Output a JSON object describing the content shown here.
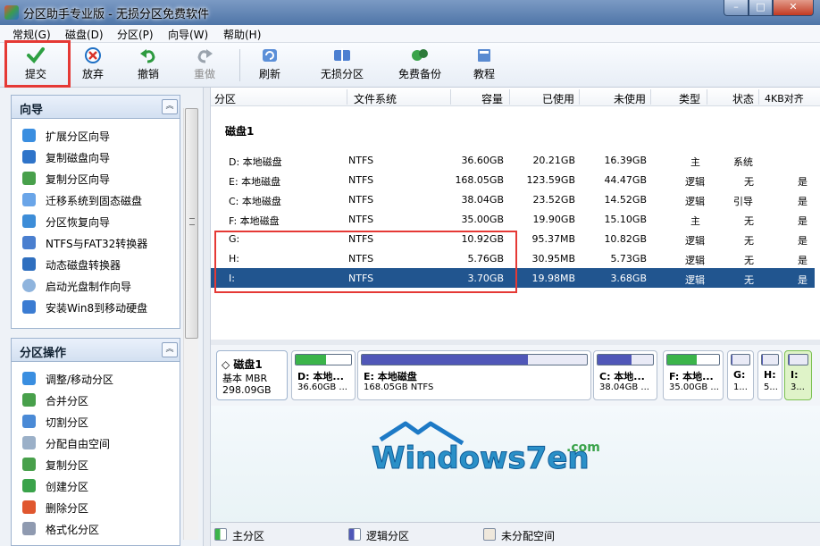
{
  "window": {
    "title": "分区助手专业版 - 无损分区免费软件",
    "min": "–",
    "max": "□",
    "close": "✕"
  },
  "menu": [
    "常规(G)",
    "磁盘(D)",
    "分区(P)",
    "向导(W)",
    "帮助(H)"
  ],
  "toolbar": {
    "submit": "提交",
    "discard": "放弃",
    "undo": "撤销",
    "redo": "重做",
    "refresh": "刷新",
    "lossless": "无损分区",
    "backup": "免费备份",
    "tutorial": "教程"
  },
  "wizard_panel": {
    "title": "向导",
    "items": [
      "扩展分区向导",
      "复制磁盘向导",
      "复制分区向导",
      "迁移系统到固态磁盘",
      "分区恢复向导",
      "NTFS与FAT32转换器",
      "动态磁盘转换器",
      "启动光盘制作向导",
      "安装Win8到移动硬盘"
    ]
  },
  "partition_panel": {
    "title": "分区操作",
    "items": [
      "调整/移动分区",
      "合并分区",
      "切割分区",
      "分配自由空间",
      "复制分区",
      "创建分区",
      "删除分区",
      "格式化分区"
    ]
  },
  "columns": [
    "分区",
    "文件系统",
    "容量",
    "已使用",
    "未使用",
    "类型",
    "状态",
    "4KB对齐"
  ],
  "disk_title": "磁盘1",
  "partitions": [
    {
      "name": "D: 本地磁盘",
      "fs": "NTFS",
      "capacity": "36.60GB",
      "used": "20.21GB",
      "free": "16.39GB",
      "type": "主",
      "status": "系统",
      "align": ""
    },
    {
      "name": "E: 本地磁盘",
      "fs": "NTFS",
      "capacity": "168.05GB",
      "used": "123.59GB",
      "free": "44.47GB",
      "type": "逻辑",
      "status": "无",
      "align": "是"
    },
    {
      "name": "C: 本地磁盘",
      "fs": "NTFS",
      "capacity": "38.04GB",
      "used": "23.52GB",
      "free": "14.52GB",
      "type": "逻辑",
      "status": "引导",
      "align": "是"
    },
    {
      "name": "F: 本地磁盘",
      "fs": "NTFS",
      "capacity": "35.00GB",
      "used": "19.90GB",
      "free": "15.10GB",
      "type": "主",
      "status": "无",
      "align": "是"
    },
    {
      "name": "G:",
      "fs": "NTFS",
      "capacity": "10.92GB",
      "used": "95.37MB",
      "free": "10.82GB",
      "type": "逻辑",
      "status": "无",
      "align": "是"
    },
    {
      "name": "H:",
      "fs": "NTFS",
      "capacity": "5.76GB",
      "used": "30.95MB",
      "free": "5.73GB",
      "type": "逻辑",
      "status": "无",
      "align": "是"
    },
    {
      "name": "I:",
      "fs": "NTFS",
      "capacity": "3.70GB",
      "used": "19.98MB",
      "free": "3.68GB",
      "type": "逻辑",
      "status": "无",
      "align": "是"
    }
  ],
  "diskmap": {
    "disk": {
      "name": "磁盘1",
      "kind": "基本 MBR",
      "size": "298.09GB"
    },
    "boxes": [
      {
        "name": "D: 本地...",
        "size": "36.60GB ...",
        "used_frac": 0.55,
        "kind": "primary"
      },
      {
        "name": "E: 本地磁盘",
        "size": "168.05GB NTFS",
        "used_frac": 0.74,
        "kind": "logical"
      },
      {
        "name": "C: 本地...",
        "size": "38.04GB ...",
        "used_frac": 0.62,
        "kind": "logical"
      },
      {
        "name": "F: 本地...",
        "size": "35.00GB ...",
        "used_frac": 0.57,
        "kind": "primary"
      },
      {
        "name": "G:",
        "size": "1...",
        "used_frac": 0.01,
        "kind": "logical"
      },
      {
        "name": "H:",
        "size": "5...",
        "used_frac": 0.01,
        "kind": "logical"
      },
      {
        "name": "I:",
        "size": "3...",
        "used_frac": 0.01,
        "kind": "logical"
      }
    ]
  },
  "logo": {
    "text": "Windows7en",
    "tld": ".com"
  },
  "legend": {
    "primary": "主分区",
    "logical": "逻辑分区",
    "unallocated": "未分配空间"
  },
  "colors": {
    "primary": "#3bb44a",
    "logical": "#5057b8",
    "selected": "#21558f",
    "highlight": "#e53935",
    "unallocated": "#efe8dc"
  }
}
